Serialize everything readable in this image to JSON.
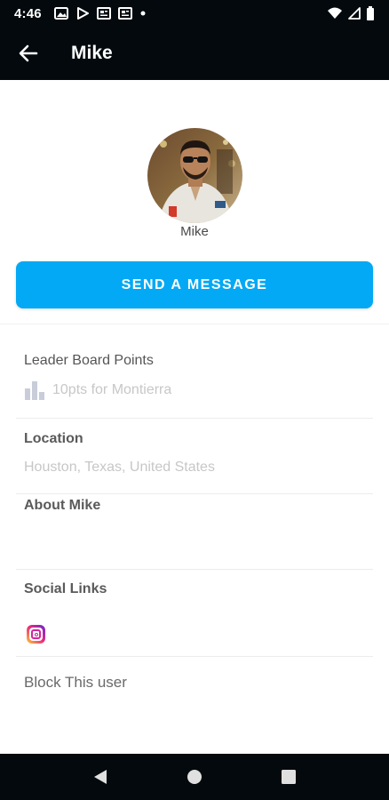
{
  "status_bar": {
    "time": "4:46",
    "left_icons": [
      "photo-icon",
      "play-store-icon",
      "news-icon",
      "news-icon",
      "dot-icon"
    ],
    "right_icons": [
      "wifi-icon",
      "signal-icon",
      "battery-icon"
    ]
  },
  "app_bar": {
    "back_icon": "arrow-back-icon",
    "title": "Mike"
  },
  "profile": {
    "name": "Mike",
    "send_button_label": "SEND A MESSAGE"
  },
  "leaderboard": {
    "title": "Leader Board Points",
    "icon": "bar-chart-icon",
    "value": "10pts for Montierra"
  },
  "location": {
    "title": "Location",
    "value": "Houston, Texas, United States"
  },
  "about": {
    "title": "About Mike"
  },
  "social": {
    "title": "Social Links",
    "links": [
      "instagram-icon"
    ]
  },
  "actions": {
    "block_label": "Block This user"
  },
  "colors": {
    "app_bar_bg": "#03090c",
    "accent": "#03a9f4",
    "muted_text": "#c7c7c7"
  }
}
